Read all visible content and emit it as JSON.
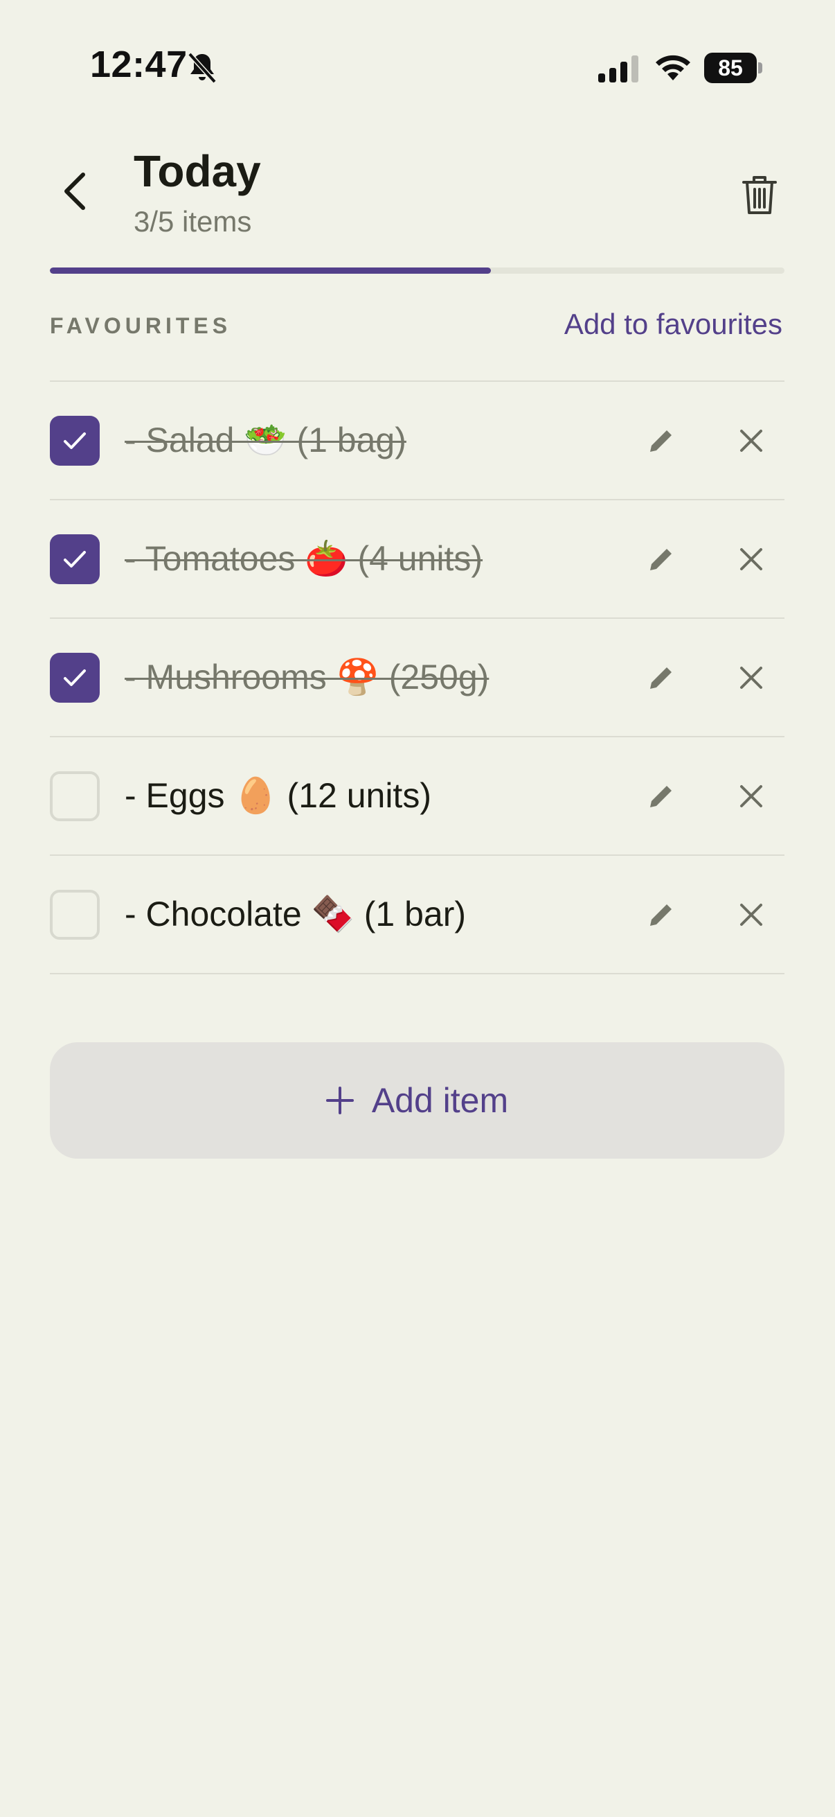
{
  "status_bar": {
    "time": "12:47",
    "battery": "85",
    "icons": [
      "bell-off-icon",
      "signal-icon",
      "wifi-icon",
      "battery-icon"
    ]
  },
  "header": {
    "title": "Today",
    "subtitle": "3/5 items",
    "back_icon": "chevron-left-icon",
    "delete_icon": "trash-icon"
  },
  "progress": {
    "done": 3,
    "total": 5,
    "fraction": 0.6,
    "color": "#53408a"
  },
  "favourites": {
    "label": "FAVOURITES",
    "add_link": "Add to favourites"
  },
  "items": [
    {
      "text": "- Salad 🥗 (1 bag)",
      "checked": true
    },
    {
      "text": "- Tomatoes 🍅 (4 units)",
      "checked": true
    },
    {
      "text": "- Mushrooms 🍄 (250g)",
      "checked": true
    },
    {
      "text": "- Eggs 🥚 (12 units)",
      "checked": false
    },
    {
      "text": "- Chocolate 🍫 (1 bar)",
      "checked": false
    }
  ],
  "add_button": {
    "label": "Add item",
    "icon": "plus-icon"
  },
  "colors": {
    "accent": "#53408a",
    "background": "#f1f2e8",
    "muted_text": "#76786b"
  }
}
